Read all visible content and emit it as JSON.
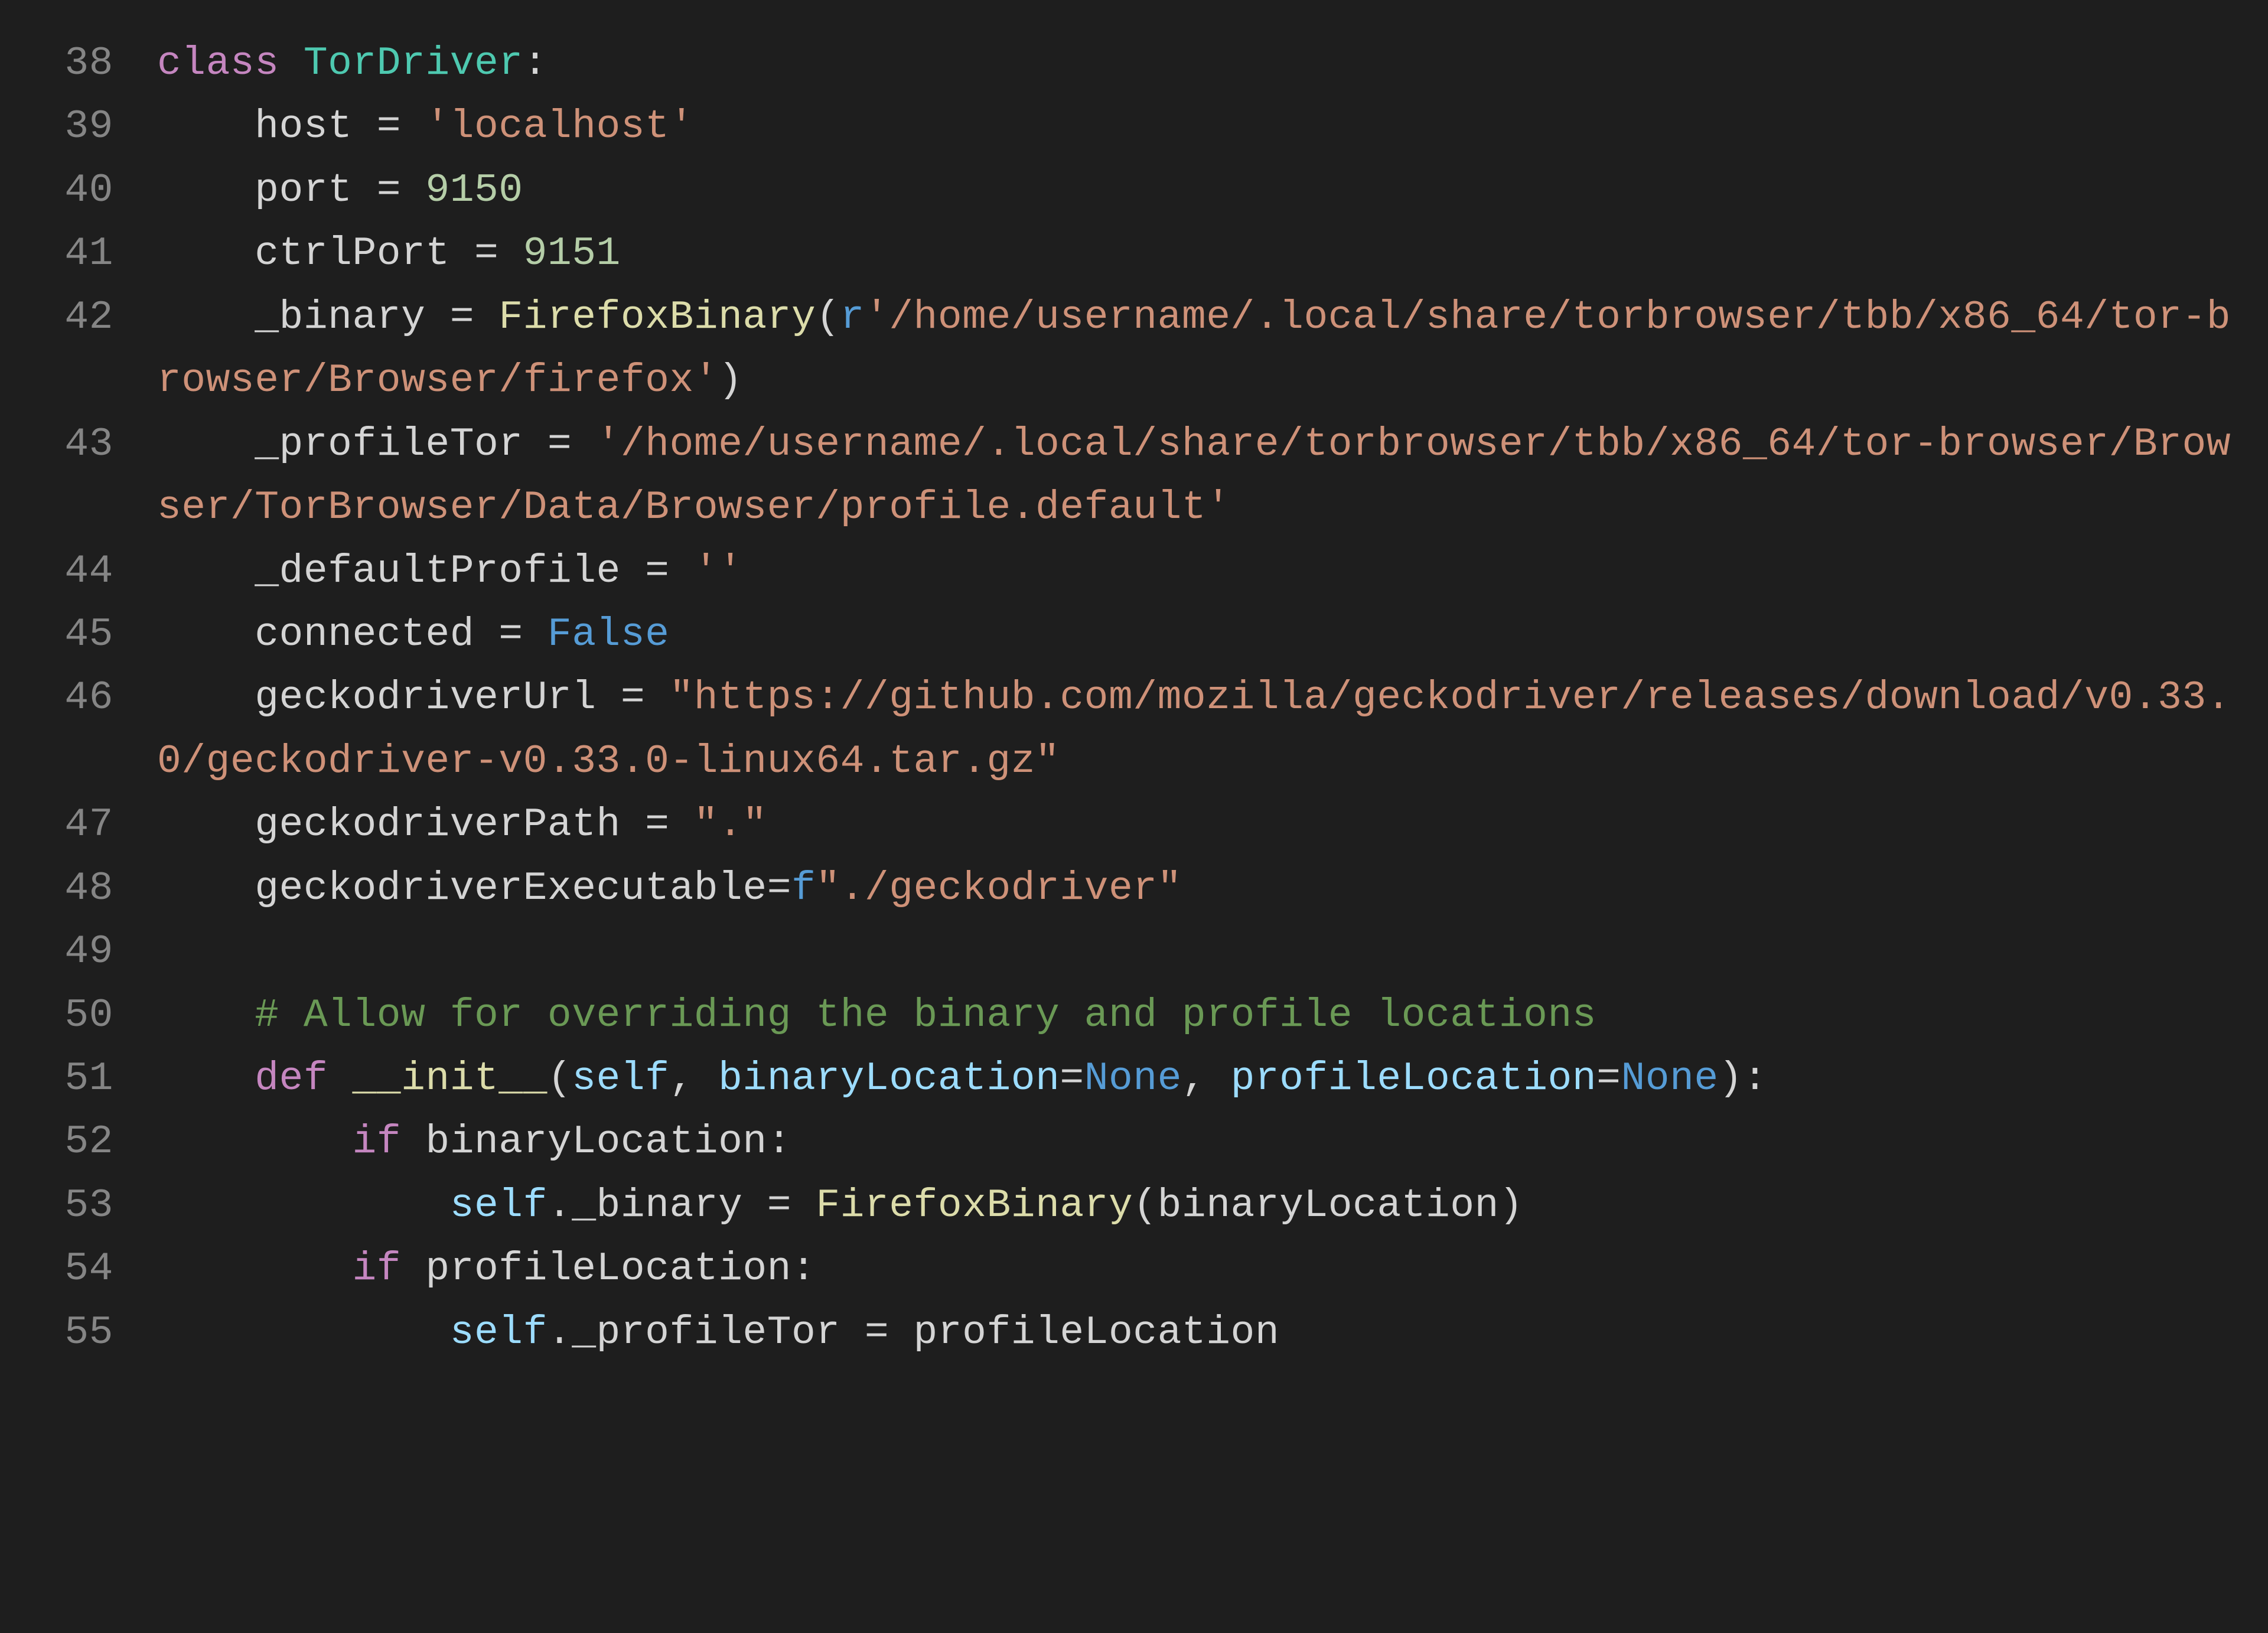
{
  "language": "python",
  "theme": "dark",
  "colors": {
    "background": "#1e1e1e",
    "foreground": "#d4d4d4",
    "gutter": "#858585",
    "keyword": "#c586c0",
    "class": "#4ec9b0",
    "function": "#dcdcaa",
    "string": "#ce9178",
    "number": "#b5cea8",
    "constant": "#569cd6",
    "comment": "#6a9955",
    "parameter": "#9cdcfe"
  },
  "lines": [
    {
      "num": "38",
      "tokens": [
        {
          "c": "kw",
          "t": "class"
        },
        {
          "c": "op",
          "t": " "
        },
        {
          "c": "cls",
          "t": "TorDriver"
        },
        {
          "c": "op",
          "t": ":"
        }
      ]
    },
    {
      "num": "39",
      "tokens": [
        {
          "c": "op",
          "t": "    "
        },
        {
          "c": "ident",
          "t": "host"
        },
        {
          "c": "op",
          "t": " = "
        },
        {
          "c": "str",
          "t": "'localhost'"
        }
      ]
    },
    {
      "num": "40",
      "tokens": [
        {
          "c": "op",
          "t": "    "
        },
        {
          "c": "ident",
          "t": "port"
        },
        {
          "c": "op",
          "t": " = "
        },
        {
          "c": "num",
          "t": "9150"
        }
      ]
    },
    {
      "num": "41",
      "tokens": [
        {
          "c": "op",
          "t": "    "
        },
        {
          "c": "ident",
          "t": "ctrlPort"
        },
        {
          "c": "op",
          "t": " = "
        },
        {
          "c": "num",
          "t": "9151"
        }
      ]
    },
    {
      "num": "42",
      "tokens": [
        {
          "c": "op",
          "t": "    "
        },
        {
          "c": "ident",
          "t": "_binary"
        },
        {
          "c": "op",
          "t": " = "
        },
        {
          "c": "fn",
          "t": "FirefoxBinary"
        },
        {
          "c": "op",
          "t": "("
        },
        {
          "c": "const",
          "t": "r"
        },
        {
          "c": "str",
          "t": "'/home/username/.local/share/torbrowser/tbb/x86_64/tor-browser/Browser/firefox'"
        },
        {
          "c": "op",
          "t": ")"
        }
      ]
    },
    {
      "num": "43",
      "tokens": [
        {
          "c": "op",
          "t": "    "
        },
        {
          "c": "ident",
          "t": "_profileTor"
        },
        {
          "c": "op",
          "t": " = "
        },
        {
          "c": "str",
          "t": "'/home/username/.local/share/torbrowser/tbb/x86_64/tor-browser/Browser/TorBrowser/Data/Browser/profile.default'"
        }
      ]
    },
    {
      "num": "44",
      "tokens": [
        {
          "c": "op",
          "t": "    "
        },
        {
          "c": "ident",
          "t": "_defaultProfile"
        },
        {
          "c": "op",
          "t": " = "
        },
        {
          "c": "str",
          "t": "''"
        }
      ]
    },
    {
      "num": "45",
      "tokens": [
        {
          "c": "op",
          "t": "    "
        },
        {
          "c": "ident",
          "t": "connected"
        },
        {
          "c": "op",
          "t": " = "
        },
        {
          "c": "const",
          "t": "False"
        }
      ]
    },
    {
      "num": "46",
      "tokens": [
        {
          "c": "op",
          "t": "    "
        },
        {
          "c": "ident",
          "t": "geckodriverUrl"
        },
        {
          "c": "op",
          "t": " = "
        },
        {
          "c": "str",
          "t": "\"https://github.com/mozilla/geckodriver/releases/download/v0.33.0/geckodriver-v0.33.0-linux64.tar.gz\""
        }
      ]
    },
    {
      "num": "47",
      "tokens": [
        {
          "c": "op",
          "t": "    "
        },
        {
          "c": "ident",
          "t": "geckodriverPath"
        },
        {
          "c": "op",
          "t": " = "
        },
        {
          "c": "str",
          "t": "\".\""
        }
      ]
    },
    {
      "num": "48",
      "tokens": [
        {
          "c": "op",
          "t": "    "
        },
        {
          "c": "ident",
          "t": "geckodriverExecutable"
        },
        {
          "c": "op",
          "t": "="
        },
        {
          "c": "const",
          "t": "f"
        },
        {
          "c": "str",
          "t": "\"./geckodriver\""
        }
      ]
    },
    {
      "num": "49",
      "tokens": [
        {
          "c": "op",
          "t": ""
        }
      ]
    },
    {
      "num": "50",
      "tokens": [
        {
          "c": "op",
          "t": "    "
        },
        {
          "c": "cmt",
          "t": "# Allow for overriding the binary and profile locations"
        }
      ]
    },
    {
      "num": "51",
      "tokens": [
        {
          "c": "op",
          "t": "    "
        },
        {
          "c": "kw",
          "t": "def"
        },
        {
          "c": "op",
          "t": " "
        },
        {
          "c": "dunder",
          "t": "__init__"
        },
        {
          "c": "op",
          "t": "("
        },
        {
          "c": "param",
          "t": "self"
        },
        {
          "c": "op",
          "t": ", "
        },
        {
          "c": "param",
          "t": "binaryLocation"
        },
        {
          "c": "op",
          "t": "="
        },
        {
          "c": "const",
          "t": "None"
        },
        {
          "c": "op",
          "t": ", "
        },
        {
          "c": "param",
          "t": "profileLocation"
        },
        {
          "c": "op",
          "t": "="
        },
        {
          "c": "const",
          "t": "None"
        },
        {
          "c": "op",
          "t": "):"
        }
      ]
    },
    {
      "num": "52",
      "tokens": [
        {
          "c": "op",
          "t": "        "
        },
        {
          "c": "kw",
          "t": "if"
        },
        {
          "c": "op",
          "t": " "
        },
        {
          "c": "ident",
          "t": "binaryLocation"
        },
        {
          "c": "op",
          "t": ":"
        }
      ]
    },
    {
      "num": "53",
      "tokens": [
        {
          "c": "op",
          "t": "            "
        },
        {
          "c": "param",
          "t": "self"
        },
        {
          "c": "op",
          "t": "."
        },
        {
          "c": "ident",
          "t": "_binary"
        },
        {
          "c": "op",
          "t": " = "
        },
        {
          "c": "fn",
          "t": "FirefoxBinary"
        },
        {
          "c": "op",
          "t": "("
        },
        {
          "c": "ident",
          "t": "binaryLocation"
        },
        {
          "c": "op",
          "t": ")"
        }
      ]
    },
    {
      "num": "54",
      "tokens": [
        {
          "c": "op",
          "t": "        "
        },
        {
          "c": "kw",
          "t": "if"
        },
        {
          "c": "op",
          "t": " "
        },
        {
          "c": "ident",
          "t": "profileLocation"
        },
        {
          "c": "op",
          "t": ":"
        }
      ]
    },
    {
      "num": "55",
      "tokens": [
        {
          "c": "op",
          "t": "            "
        },
        {
          "c": "param",
          "t": "self"
        },
        {
          "c": "op",
          "t": "."
        },
        {
          "c": "ident",
          "t": "_profileTor"
        },
        {
          "c": "op",
          "t": " = "
        },
        {
          "c": "ident",
          "t": "profileLocation"
        }
      ]
    }
  ]
}
